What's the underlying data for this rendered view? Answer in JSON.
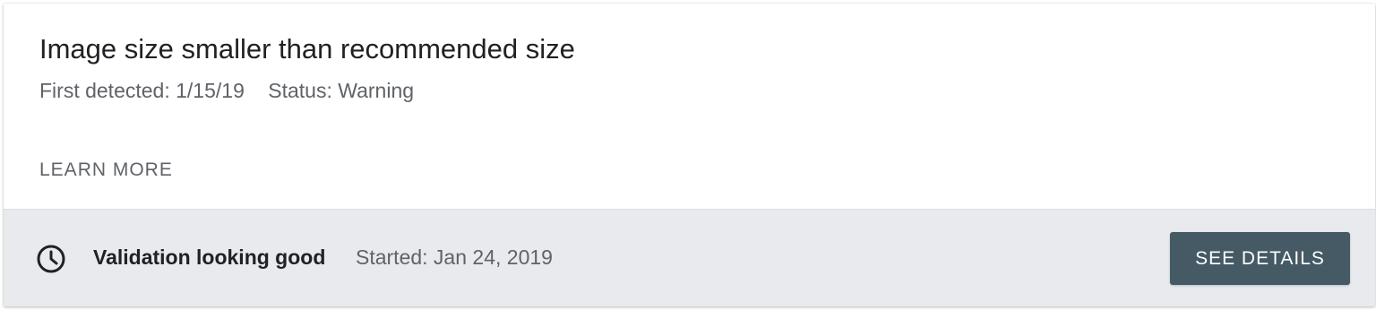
{
  "issue": {
    "title": "Image size smaller than recommended size",
    "first_detected": "First detected: 1/15/19",
    "status": "Status: Warning",
    "learn_more_label": "LEARN MORE"
  },
  "validation": {
    "icon": "clock-icon",
    "label": "Validation looking good",
    "started": "Started: Jan 24, 2019",
    "see_details_label": "SEE DETAILS"
  },
  "colors": {
    "footer_background": "#e8eaed",
    "button_background": "#455a64",
    "title_text": "#202124",
    "secondary_text": "#5f6368"
  }
}
